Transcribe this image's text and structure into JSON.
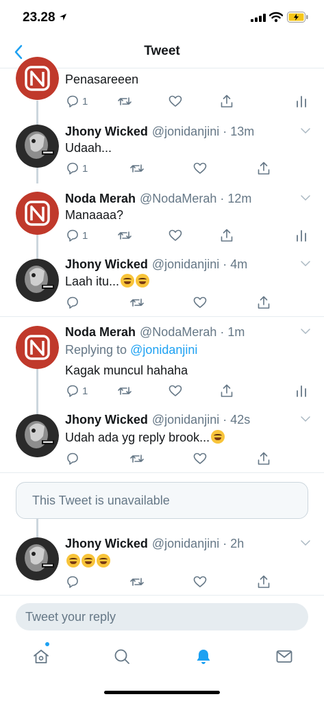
{
  "status_bar": {
    "time": "23.28"
  },
  "nav": {
    "title": "Tweet"
  },
  "tweets": [
    {
      "name": "",
      "handle": "",
      "time": "",
      "text": "Penasareeen",
      "reply_count": "1",
      "author": "noda"
    },
    {
      "name": "Jhony Wicked",
      "handle": "@jonidanjini",
      "time": "13m",
      "text": "Udaah...",
      "reply_count": "1",
      "author": "jhony"
    },
    {
      "name": "Noda Merah",
      "handle": "@NodaMerah",
      "time": "12m",
      "text": "Manaaaa?",
      "reply_count": "1",
      "author": "noda"
    },
    {
      "name": "Jhony Wicked",
      "handle": "@jonidanjini",
      "time": "4m",
      "text": "Laah itu...",
      "reply_count": "",
      "author": "jhony"
    },
    {
      "name": "Noda Merah",
      "handle": "@NodaMerah",
      "time": "1m",
      "replying_label": "Replying to",
      "replying_to": "@jonidanjini",
      "text": "Kagak muncul hahaha",
      "reply_count": "1",
      "author": "noda"
    },
    {
      "name": "Jhony Wicked",
      "handle": "@jonidanjini",
      "time": "42s",
      "text": "Udah ada yg reply brook...",
      "reply_count": "",
      "author": "jhony"
    },
    {
      "name": "Jhony Wicked",
      "handle": "@jonidanjini",
      "time": "2h",
      "text": "",
      "reply_count": "",
      "author": "jhony"
    }
  ],
  "unavailable": {
    "text": "This Tweet is unavailable"
  },
  "reply_bar": {
    "placeholder": "Tweet your reply"
  },
  "tab_bar": {
    "items": [
      "home-icon",
      "search-icon",
      "notifications-icon",
      "messages-icon"
    ],
    "active": "notifications-icon"
  },
  "colors": {
    "accent": "#1da1f2",
    "text_secondary": "#657786",
    "noda_red": "#c0392b",
    "divider": "#e6ecf0"
  },
  "icons": {
    "reply": "reply-icon",
    "retweet": "retweet-icon",
    "like": "like-icon",
    "share": "share-icon",
    "analytics": "analytics-icon",
    "emoji": "rofl-emoji",
    "grin": "grin-emoji"
  }
}
